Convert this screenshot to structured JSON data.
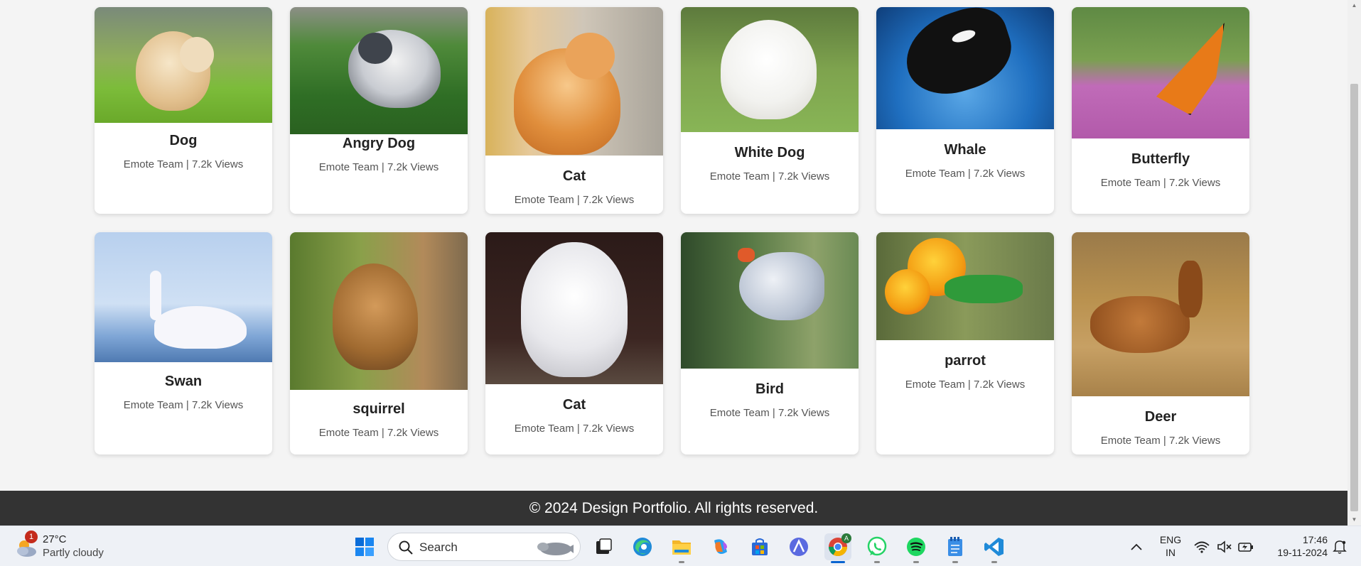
{
  "cards": [
    {
      "title": "Dog",
      "meta": "Emote Team | 7.2k Views"
    },
    {
      "title": "Angry Dog",
      "meta": "Emote Team | 7.2k Views"
    },
    {
      "title": "Cat",
      "meta": "Emote Team | 7.2k Views"
    },
    {
      "title": "White Dog",
      "meta": "Emote Team | 7.2k Views"
    },
    {
      "title": "Whale",
      "meta": "Emote Team | 7.2k Views"
    },
    {
      "title": "Butterfly",
      "meta": "Emote Team | 7.2k Views"
    },
    {
      "title": "Swan",
      "meta": "Emote Team | 7.2k Views"
    },
    {
      "title": "squirrel",
      "meta": "Emote Team | 7.2k Views"
    },
    {
      "title": "Cat",
      "meta": "Emote Team | 7.2k Views"
    },
    {
      "title": "Bird",
      "meta": "Emote Team | 7.2k Views"
    },
    {
      "title": "parrot",
      "meta": "Emote Team | 7.2k Views"
    },
    {
      "title": "Deer",
      "meta": "Emote Team | 7.2k Views"
    }
  ],
  "footer": {
    "text": "© 2024 Design Portfolio. All rights reserved."
  },
  "taskbar": {
    "weather": {
      "temp": "27°C",
      "condition": "Partly cloudy",
      "badge": "1"
    },
    "search": {
      "label": "Search"
    },
    "language": {
      "line1": "ENG",
      "line2": "IN"
    },
    "clock": {
      "time": "17:46",
      "date": "19-11-2024"
    },
    "chrome_badge": "A"
  }
}
